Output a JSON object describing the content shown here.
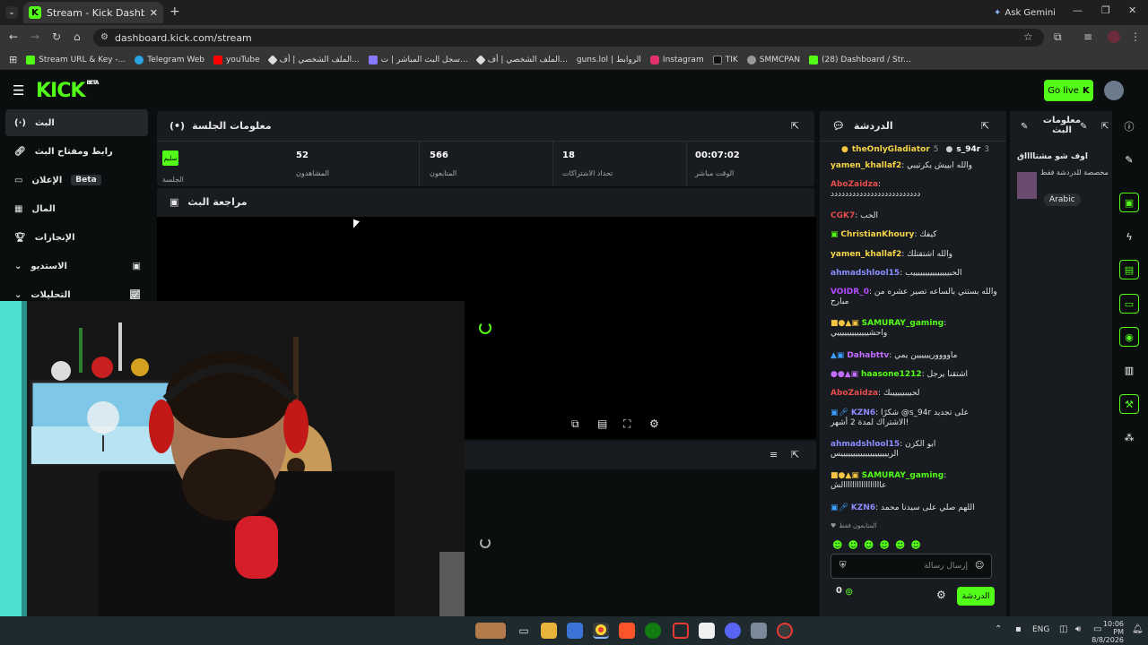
{
  "browser": {
    "tab_title": "Stream - Kick Dashboard",
    "address": "dashboard.kick.com/stream",
    "ask_gemini": "Ask Gemini",
    "bookmarks": [
      {
        "label": "Stream URL & Key -...",
        "color": "#53fc18"
      },
      {
        "label": "Telegram Web",
        "color": "#2aa3e0"
      },
      {
        "label": "youTube",
        "color": "#ff0000"
      },
      {
        "label": "الملف الشخصي | أف...",
        "color": "#dddddd"
      },
      {
        "label": "سجل البث المباشر | ت...",
        "color": "#8877ff"
      },
      {
        "label": "الملف الشخصي | أف...",
        "color": "#dddddd"
      },
      {
        "label": "guns.lol | الروابط",
        "color": "#222222"
      },
      {
        "label": "Instagram",
        "color": "#e1306c"
      },
      {
        "label": "TIK",
        "color": "#111111"
      },
      {
        "label": "SMMCPAN",
        "color": "#999999"
      },
      {
        "label": "(28) Dashboard / Str...",
        "color": "#53fc18"
      }
    ]
  },
  "kick": {
    "logo": "KICK",
    "beta": "BETA",
    "go_live": "Go live"
  },
  "sidebar": {
    "items": [
      {
        "label": "البث"
      },
      {
        "label": "رابط ومفتاح البث"
      },
      {
        "label": "الإعلان",
        "badge": "Beta"
      },
      {
        "label": "المال"
      },
      {
        "label": "الإنجازات"
      },
      {
        "label": "الاستديو"
      },
      {
        "label": "التحليلات"
      }
    ]
  },
  "session": {
    "title": "معلومات الجلسة",
    "session_badge": "سليم",
    "session_label": "الجلسة",
    "stats": [
      {
        "value": "52",
        "label": "المشاهدون"
      },
      {
        "value": "566",
        "label": "المتابعون"
      },
      {
        "value": "18",
        "label": "تحداد الاشتراكات"
      },
      {
        "value": "00:07:02",
        "label": "الوقت مباشر"
      }
    ]
  },
  "preview": {
    "title": "مراجعة البث"
  },
  "chat": {
    "title": "الدردشة",
    "top_users": [
      {
        "name": "theOnlyGladiator",
        "count": "5"
      },
      {
        "name": "s_94r",
        "count": "3"
      }
    ],
    "messages": [
      {
        "user": "yamen_khallaf2",
        "color": "#f5d547",
        "text": "والله ابييش يكرتيبي"
      },
      {
        "user": "AboZaidza",
        "color": "#e64c4c",
        "text": "ددددددددددددددددددددددددد"
      },
      {
        "user": "CGK7",
        "color": "#e64c4c",
        "text": "الحب"
      },
      {
        "user": "ChristianKhoury",
        "color": "#f5d547",
        "text": "كيفك"
      },
      {
        "user": "yamen_khallaf2",
        "color": "#f5d547",
        "text": "والله اشتقتلك"
      },
      {
        "user": "ahmadshlool15",
        "color": "#8c8cff",
        "text": "الحبيييييييييييييييب"
      },
      {
        "user": "VOIDR_0",
        "color": "#b44cff",
        "text": "والله بستني بالساعه تصير عشره من مبارح"
      },
      {
        "user": "SAMURAY_gaming",
        "color": "#53fc18",
        "text": "واحشيييييييييييييي"
      },
      {
        "user": "Dahabttv",
        "color": "#c46cff",
        "text": "ماووووريييييين يمي"
      },
      {
        "user": "haasone1212",
        "color": "#53fc18",
        "text": "اشتقنا يرجل"
      },
      {
        "user": "AboZaidza",
        "color": "#e64c4c",
        "text": "لحبيبيييييبك"
      },
      {
        "user": "KZN6",
        "color": "#8c8cff",
        "text": "شكرًا @s_94r على تجديد الاشتراك لمدة 2 أشهر!"
      },
      {
        "user": "ahmadshlool15",
        "color": "#8c8cff",
        "text": "ابو الكزن الرييييييييييييييييييييس"
      },
      {
        "user": "SAMURAY_gaming",
        "color": "#53fc18",
        "text": "عااااااااااااااااالش"
      },
      {
        "user": "KZN6",
        "color": "#8c8cff",
        "text": "اللهم صلي على سيدنا محمد"
      }
    ],
    "followers_only": "المتابعون فقط",
    "input_placeholder": "إرسال رسالة",
    "send_label": "الدردشة",
    "count": "0"
  },
  "stream_info": {
    "title": "معلومات البث",
    "stream_title": "اوف شو مشتااااق",
    "category_text": "مخصصة للدردشة فقط",
    "language": "Arabic"
  },
  "taskbar": {
    "language": "ENG",
    "time": "10:06 PM",
    "date": "8/8/2026"
  }
}
